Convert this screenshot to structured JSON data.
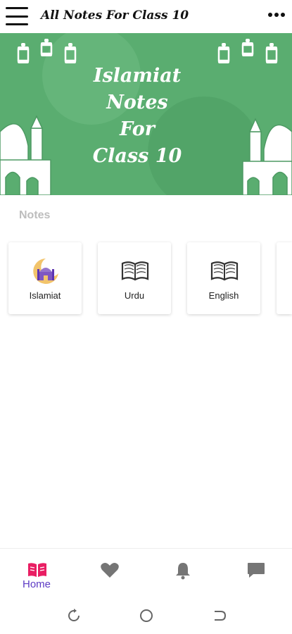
{
  "app_bar": {
    "title": "All Notes For Class 10",
    "menu_icon": "hamburger-menu-icon",
    "overflow_icon": "more-horizontal-icon"
  },
  "banner": {
    "title_lines": [
      "Islamiat",
      "Notes",
      "For",
      "Class 10"
    ],
    "background_color": "#5aad70"
  },
  "notes_section": {
    "label": "Notes",
    "cards": [
      {
        "label": "Islamiat",
        "icon": "mosque-crescent-icon"
      },
      {
        "label": "Urdu",
        "icon": "open-book-icon"
      },
      {
        "label": "English",
        "icon": "open-book-icon"
      }
    ]
  },
  "bottom_nav": {
    "items": [
      {
        "label": "Home",
        "icon": "book-icon",
        "active": true
      },
      {
        "label": "",
        "icon": "heart-icon",
        "active": false
      },
      {
        "label": "",
        "icon": "bell-icon",
        "active": false
      },
      {
        "label": "",
        "icon": "chat-icon",
        "active": false
      }
    ],
    "active_color": "#e91e63",
    "active_label_color": "#5c3bc4",
    "inactive_color": "#757575"
  },
  "system_nav": {
    "buttons": [
      "recent-apps-icon",
      "home-circle-icon",
      "back-icon"
    ]
  }
}
